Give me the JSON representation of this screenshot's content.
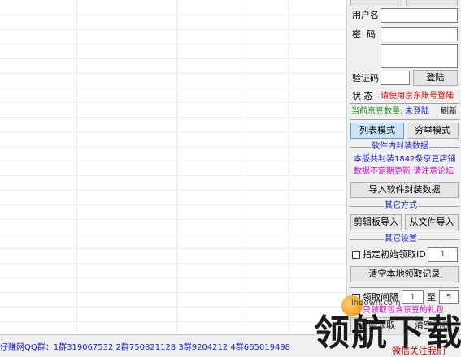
{
  "panel": {
    "top_buttons": [
      "",
      ""
    ],
    "username_label": "用户名",
    "username_value": "",
    "password_label": "密  码",
    "password_value": "",
    "captcha_label": "验证码",
    "captcha_value": "",
    "login_button": "登陆",
    "status_label": "状 态",
    "status_text": "请使用京东账号登陆",
    "bean_label": "当前京豆数量:",
    "bean_value": "未登陆",
    "refresh_link": "刷新",
    "mode_list": "列表模式",
    "mode_exhaust": "穷举模式",
    "section_builtin": "软件内封装数据",
    "builtin_line1": "本版共封装1842条京豆店铺",
    "builtin_line2": "数据不定期更新 请注意论坛",
    "import_builtin_button": "导入软件封装数据",
    "section_other_methods": "其它方式",
    "clipboard_import_button": "剪辑板导入",
    "file_import_button": "从文件导入",
    "section_other_settings": "其它设置",
    "initial_id_label": "指定初始领取ID",
    "initial_id_value": "1",
    "clear_records_button": "清空本地领取记录",
    "interval_label": "领取间隔",
    "interval_from": "1",
    "interval_to_label": "至",
    "interval_to": "5",
    "bean_only_label": "只领取包含京豆的礼包",
    "start_button": "开始领取",
    "clear_list_button": "清空列表"
  },
  "statusbar": {
    "qq_groups": "仔赚网QQ群：1群319067532  2群750821128  3群9204212  4群665019498"
  },
  "watermark": {
    "site": "lhdown.com",
    "logo_text": "领航下载",
    "tagline": "微信关注我们"
  },
  "colors": {
    "accent_blue": "#1a1ad6",
    "status_red": "#e00000",
    "bean_green": "#1a8a1a",
    "magenta": "#d000d0",
    "pressed_button": "#cce4f7"
  }
}
